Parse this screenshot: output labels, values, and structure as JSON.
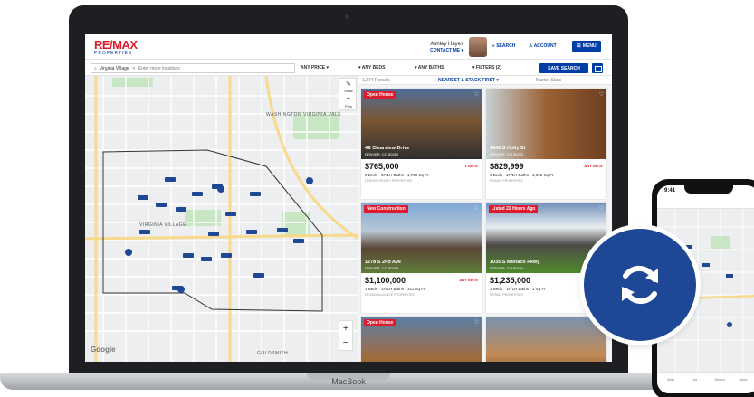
{
  "device": {
    "laptop_label": "MacBook"
  },
  "header": {
    "brand_main": "RE/MAX",
    "brand_sub": "PROPERTIES",
    "user_name": "Ashley Hayes",
    "contact_label": "CONTACT ME ▾",
    "search_label": "SEARCH",
    "account_label": "ACCOUNT",
    "menu_label": "MENU"
  },
  "filters": {
    "search_chip": "Virginia Village",
    "search_placeholder": "Enter more locations",
    "price": "ANY PRICE",
    "beds": "ANY BEDS",
    "baths": "ANY BATHS",
    "more": "FILTERS (2)",
    "save_search": "SAVE SEARCH"
  },
  "results": {
    "count": "1,274 Results",
    "sort": "NEAREST & STACK FIRST ▾",
    "market": "Market Stats"
  },
  "map": {
    "labels": [
      "WASHINGTON VIRGINIA VALE",
      "VIRGINIA VILLAGE",
      "GOLDSMITH"
    ],
    "tool_draw": "Draw",
    "tool_pin": "Pins",
    "zoom_in": "+",
    "zoom_out": "−",
    "attribution": "Google"
  },
  "listings": [
    {
      "badge": "Open House",
      "address": "4E Clearview Drive",
      "city": "DENVER, CO 80210",
      "price": "$765,000",
      "status": "1 NOTE",
      "facts": "5 Beds · 3F/1H Baths · 1,750 Sq Ft",
      "brokerage": "DENVER REALTY PROPERTIES"
    },
    {
      "badge": "",
      "address": "1440 S Holly St",
      "city": "DENVER, CO 80222",
      "price": "$829,999",
      "status": "ANY NOTE",
      "facts": "3 Beds · 1F/1H Baths · 3,065 Sq Ft",
      "brokerage": "RE/MAX PROPERTIES"
    },
    {
      "badge": "New Construction",
      "address": "1278 S 2nd Ave",
      "city": "DENVER, CO 80209",
      "price": "$1,100,000",
      "status": "ANY NOTE",
      "facts": "3 Beds · 1F/1H Baths · 311 Sq Ft",
      "brokerage": "RE/MAX ALLIANCE PROPERTIES"
    },
    {
      "badge": "Listed 22 Hours Ago",
      "address": "1035 S Monaco Pkwy",
      "city": "DENVER, CO 80224",
      "price": "$1,235,000",
      "status": "",
      "facts": "3 Beds · 1F/1H Baths · 1 Sq Ft",
      "brokerage": "RE/MAX PROPERTIES"
    },
    {
      "badge": "Open House",
      "address": "",
      "city": "",
      "price": "",
      "status": "",
      "facts": "",
      "brokerage": ""
    },
    {
      "badge": "",
      "address": "",
      "city": "",
      "price": "",
      "status": "",
      "facts": "",
      "brokerage": ""
    }
  ],
  "phone": {
    "time": "9:41",
    "tabs": [
      "Map",
      "List",
      "Saved",
      "More"
    ]
  },
  "colors": {
    "brand_blue": "#003da5",
    "brand_red": "#dc1c2e",
    "sync_blue": "#1e4896"
  }
}
